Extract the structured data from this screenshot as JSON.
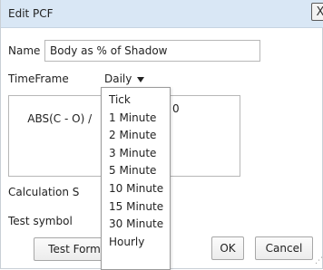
{
  "dialog": {
    "title": "Edit PCF",
    "close_glyph": "X",
    "name_label": "Name",
    "name_value": "Body as % of Shadow",
    "timeframe_label": "TimeFrame",
    "timeframe_value": "Daily",
    "formula_visible_left": "ABS(C - O) /",
    "formula_visible_right": "0",
    "calculation_label_partial": "Calculation S",
    "test_symbol_label": "Test symbol",
    "test_button_partial": "Test Form",
    "ok_label": "OK",
    "cancel_label": "Cancel"
  },
  "timeframe_dropdown": {
    "options": [
      "Tick",
      "1 Minute",
      "2 Minute",
      "3 Minute",
      "5 Minute",
      "10 Minute",
      "15 Minute",
      "30 Minute",
      "Hourly"
    ]
  },
  "icons": {
    "close": "close-icon",
    "caret": "chevron-down-icon",
    "resize": "resize-grip-icon"
  },
  "colors": {
    "titlebar_bg": "#d9e7f5",
    "border": "#b7b7b7"
  }
}
